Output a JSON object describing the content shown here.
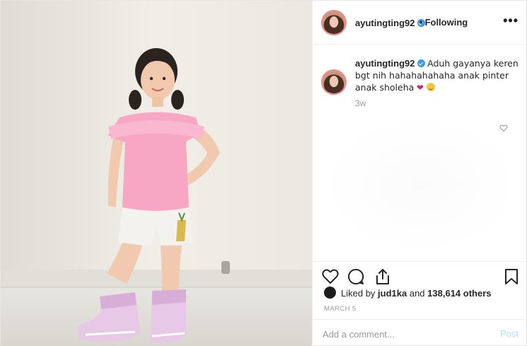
{
  "post": {
    "username": "ayutingting92",
    "follow_label": "Following",
    "follow_separator": "•",
    "more_label": "•••",
    "caption": {
      "username": "ayutingting92",
      "text": "Aduh gayanya keren bgt nih hahahahahaha anak pinter anak sholeha",
      "time": "3w"
    },
    "likes": {
      "liked_by_prefix": "Liked by ",
      "first_user": "jud1ka",
      "and_text": " and ",
      "others": "138,614 others"
    },
    "date": "MARCH 5",
    "comment": {
      "placeholder": "Add a comment...",
      "post_label": "Post"
    }
  },
  "icons": {
    "header_avatar": "profile-avatar-icon",
    "caption_avatar": "profile-avatar-icon",
    "verified": "verified-badge-icon",
    "like": "heart-icon",
    "comment": "comment-bubble-icon",
    "share": "share-icon",
    "save": "bookmark-icon",
    "comment_like": "small-heart-icon"
  },
  "colors": {
    "verified": "#3897f0",
    "text": "#262626",
    "muted": "#999999",
    "post_disabled": "#b2dffc",
    "border": "#efefef"
  }
}
